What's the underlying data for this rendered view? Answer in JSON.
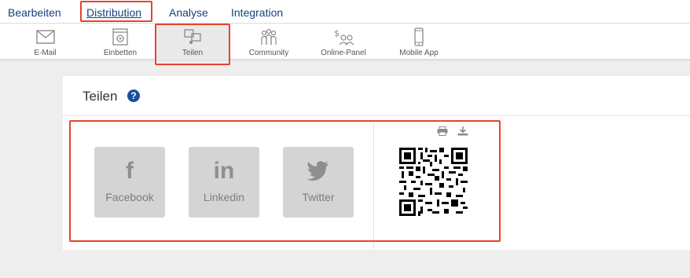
{
  "topnav": {
    "items": [
      "Bearbeiten",
      "Distribution",
      "Analyse",
      "Integration"
    ],
    "active": "Distribution"
  },
  "subnav": {
    "items": [
      {
        "label": "E-Mail",
        "icon": "mail-icon"
      },
      {
        "label": "Einbetten",
        "icon": "embed-icon"
      },
      {
        "label": "Teilen",
        "icon": "share-icon"
      },
      {
        "label": "Community",
        "icon": "community-icon"
      },
      {
        "label": "Online-Panel",
        "icon": "online-panel-icon"
      },
      {
        "label": "Mobile App",
        "icon": "mobile-app-icon"
      }
    ],
    "selected": "Teilen"
  },
  "panel": {
    "title": "Teilen",
    "help_symbol": "?"
  },
  "social": [
    {
      "label": "Facebook",
      "symbol": "f",
      "icon": "facebook-icon"
    },
    {
      "label": "Linkedin",
      "symbol": "in",
      "icon": "linkedin-icon"
    },
    {
      "label": "Twitter",
      "symbol": "🐦",
      "icon": "twitter-icon"
    }
  ],
  "qr": {
    "tools": [
      "print-icon",
      "download-icon"
    ]
  },
  "colors": {
    "nav_text": "#16407e",
    "highlight": "#e8432d",
    "social_bg": "#d4d4d4"
  }
}
